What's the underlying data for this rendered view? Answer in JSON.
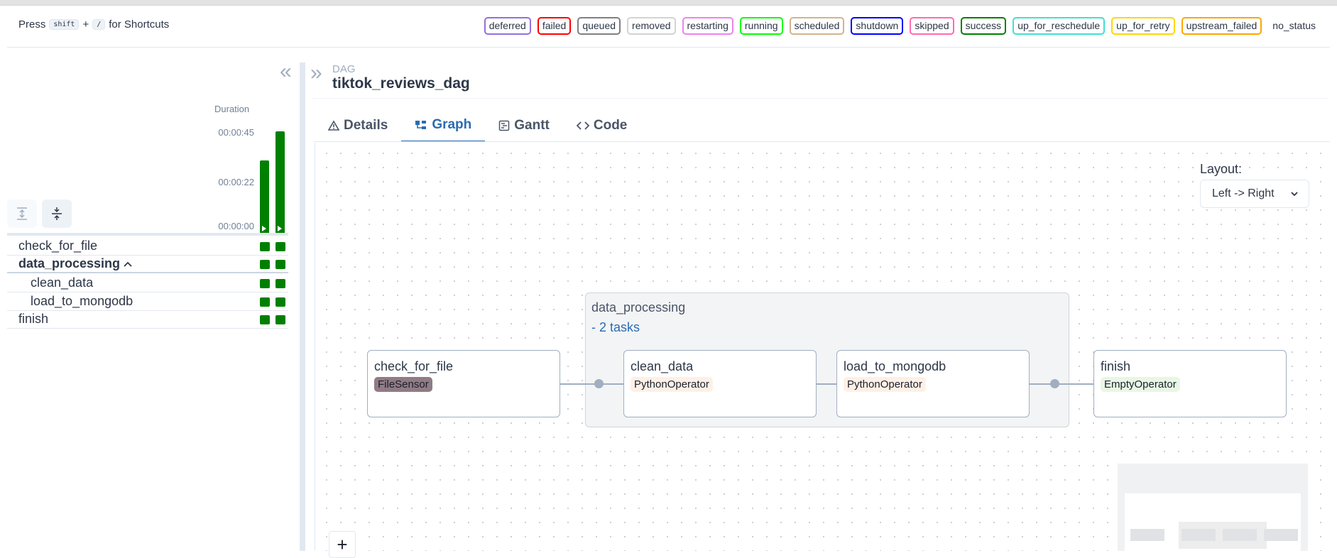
{
  "shortcuts": {
    "press": "Press",
    "key1": "shift",
    "plus": "+",
    "key2": "/",
    "suffix": "for Shortcuts"
  },
  "legend": [
    {
      "label": "deferred",
      "color": "#9370db"
    },
    {
      "label": "failed",
      "color": "#ff0000"
    },
    {
      "label": "queued",
      "color": "#808080"
    },
    {
      "label": "removed",
      "color": "#d3d3d3"
    },
    {
      "label": "restarting",
      "color": "#ee82ee"
    },
    {
      "label": "running",
      "color": "#00ff00"
    },
    {
      "label": "scheduled",
      "color": "#d2b48c"
    },
    {
      "label": "shutdown",
      "color": "#0000ff"
    },
    {
      "label": "skipped",
      "color": "#ff69b4"
    },
    {
      "label": "success",
      "color": "#008000"
    },
    {
      "label": "up_for_reschedule",
      "color": "#40e0d0"
    },
    {
      "label": "up_for_retry",
      "color": "#ffd700"
    },
    {
      "label": "upstream_failed",
      "color": "#ffa500"
    },
    {
      "label": "no_status",
      "color": ""
    }
  ],
  "grid": {
    "duration_label": "Duration",
    "ticks": [
      "00:00:45",
      "00:00:22",
      "00:00:00"
    ],
    "runs": [
      {
        "duration_fraction": 0.71,
        "state": "success"
      },
      {
        "duration_fraction": 0.99,
        "state": "success"
      }
    ],
    "tasks": [
      {
        "name": "check_for_file",
        "level": 0,
        "group": false,
        "states": [
          "success",
          "success"
        ]
      },
      {
        "name": "data_processing",
        "level": 0,
        "group": true,
        "expanded_icon": "chevron-up-icon",
        "states": [
          "success",
          "success"
        ]
      },
      {
        "name": "clean_data",
        "level": 1,
        "group": false,
        "states": [
          "success",
          "success"
        ]
      },
      {
        "name": "load_to_mongodb",
        "level": 1,
        "group": false,
        "states": [
          "success",
          "success"
        ]
      },
      {
        "name": "finish",
        "level": 0,
        "group": false,
        "states": [
          "success",
          "success"
        ]
      }
    ]
  },
  "dag": {
    "label": "DAG",
    "title": "tiktok_reviews_dag"
  },
  "tabs": [
    {
      "label": "Details",
      "icon": "warning-triangle-icon",
      "active": false
    },
    {
      "label": "Graph",
      "icon": "graph-icon",
      "active": true
    },
    {
      "label": "Gantt",
      "icon": "gantt-icon",
      "active": false
    },
    {
      "label": "Code",
      "icon": "code-icon",
      "active": false
    }
  ],
  "graph": {
    "layout_label": "Layout:",
    "layout_value": "Left -> Right",
    "group": {
      "name": "data_processing",
      "count_text": "- 2 tasks"
    },
    "nodes": [
      {
        "name": "check_for_file",
        "operator": "FileSensor",
        "op_color": "#917b84",
        "op_text_color": "#1a202c"
      },
      {
        "name": "clean_data",
        "operator": "PythonOperator",
        "op_color": "#fff0e6",
        "op_text_color": "#1a202c"
      },
      {
        "name": "load_to_mongodb",
        "operator": "PythonOperator",
        "op_color": "#fff0e6",
        "op_text_color": "#1a202c"
      },
      {
        "name": "finish",
        "operator": "EmptyOperator",
        "op_color": "#e8f7e4",
        "op_text_color": "#1a202c"
      }
    ],
    "zoom_in_label": "+"
  }
}
